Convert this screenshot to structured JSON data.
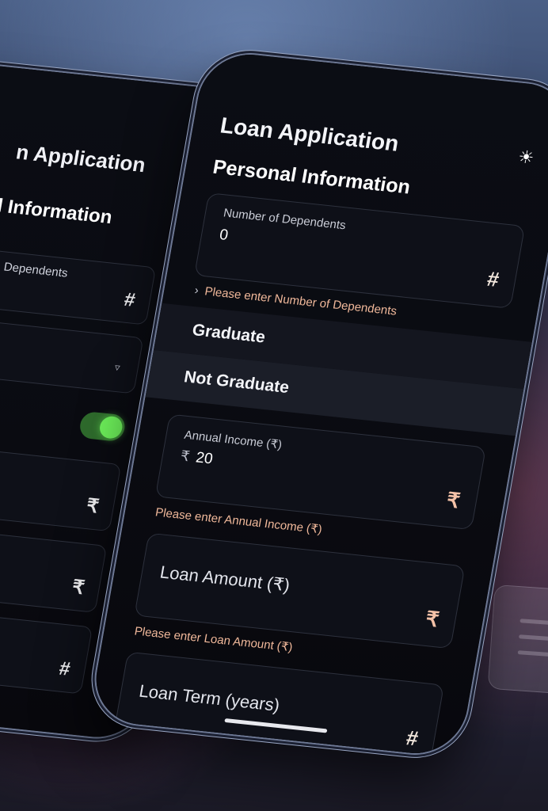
{
  "main_phone": {
    "app_title": "Loan Application",
    "theme_icon": "sun-icon",
    "section_title": "Personal Information",
    "dependents": {
      "label": "Number of Dependents",
      "value": "0",
      "suffix_icon": "#",
      "error": "Please enter Number of Dependents"
    },
    "education_options": [
      "Graduate",
      "Not Graduate"
    ],
    "annual_income": {
      "label": "Annual Income (₹)",
      "prefix": "₹",
      "value": "20",
      "suffix_icon": "₹",
      "error": "Please enter Annual Income (₹)"
    },
    "loan_amount": {
      "placeholder": "Loan Amount (₹)",
      "suffix_icon": "₹",
      "error": "Please enter Loan Amount (₹)"
    },
    "loan_term": {
      "placeholder": "Loan Term (years)",
      "suffix_icon": "#"
    }
  },
  "back_phone": {
    "app_title": "n Application",
    "section_title": "l Information",
    "dependents_label": "Dependents",
    "select_arrow": "▿",
    "toggle_on": true,
    "field_icons": [
      "₹",
      "₹",
      "#"
    ]
  },
  "colors": {
    "error_text": "#f0b89a",
    "toggle_on": "#6df05a",
    "screen_bg": "#0a0b11"
  }
}
